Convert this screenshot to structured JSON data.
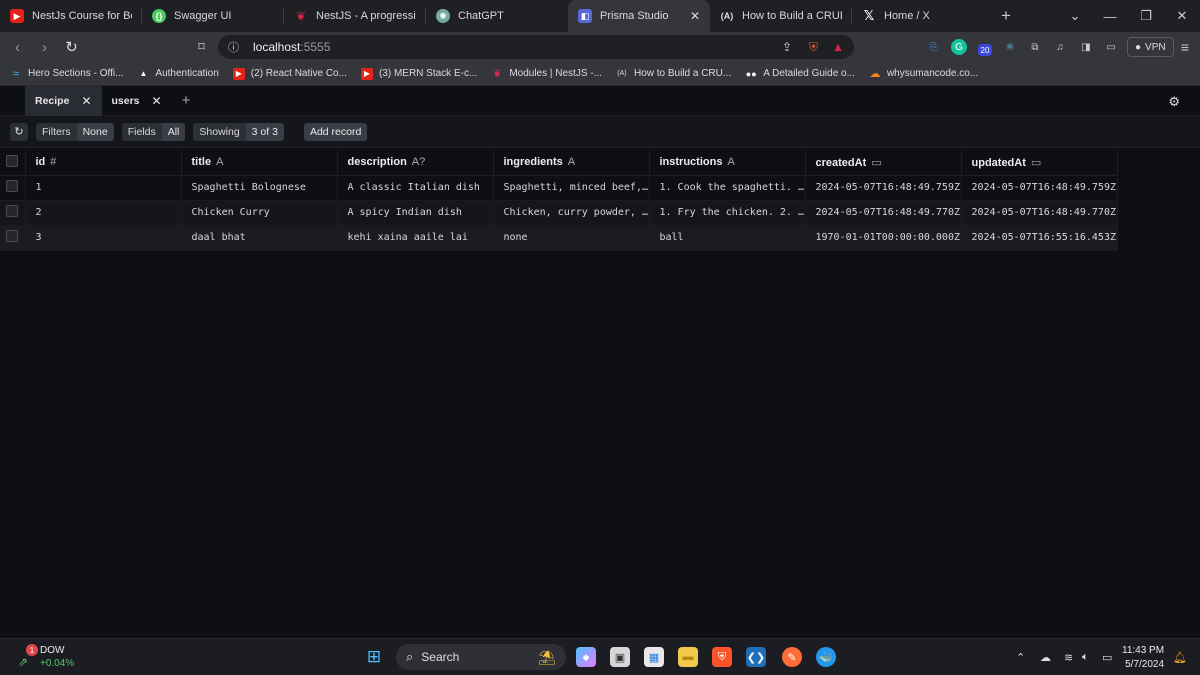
{
  "browser": {
    "tabs": [
      {
        "label": "NestJs Course for Beginne",
        "icon": "youtube-icon",
        "active": false
      },
      {
        "label": "Swagger UI",
        "icon": "swagger-icon",
        "active": false
      },
      {
        "label": "NestJS - A progressive No",
        "icon": "nestjs-icon",
        "active": false
      },
      {
        "label": "ChatGPT",
        "icon": "chatgpt-icon",
        "active": false
      },
      {
        "label": "Prisma Studio",
        "icon": "prisma-icon",
        "active": true
      },
      {
        "label": "How to Build a CRUD RES",
        "icon": "a-icon",
        "active": false
      },
      {
        "label": "Home / X",
        "icon": "x-icon",
        "active": false
      }
    ],
    "new_tab": "+",
    "url_host": "localhost",
    "url_port": ":5555",
    "vpn_label": "VPN",
    "ext_badge": "20",
    "bookmarks": [
      {
        "label": "Hero Sections - Offi...",
        "icon": "wave-icon"
      },
      {
        "label": "Authentication",
        "icon": "triangle-icon"
      },
      {
        "label": "(2) React Native Co...",
        "icon": "youtube-icon"
      },
      {
        "label": "(3) MERN Stack E-c...",
        "icon": "youtube-icon"
      },
      {
        "label": "Modules | NestJS -...",
        "icon": "nestjs-icon"
      },
      {
        "label": "How to Build a CRU...",
        "icon": "a-icon"
      },
      {
        "label": "A Detailed Guide o...",
        "icon": "medium-icon"
      },
      {
        "label": "whysumancode.co...",
        "icon": "cloud-icon"
      }
    ]
  },
  "studio": {
    "model_tabs": [
      {
        "label": "Recipe",
        "active": false
      },
      {
        "label": "users",
        "active": true
      }
    ],
    "toolbar": {
      "filters_label": "Filters",
      "filters_value": "None",
      "fields_label": "Fields",
      "fields_value": "All",
      "showing_label": "Showing",
      "showing_value": "3 of 3",
      "add_record": "Add record"
    },
    "columns": [
      {
        "name": "id",
        "type": "#"
      },
      {
        "name": "title",
        "type": "A"
      },
      {
        "name": "description",
        "type": "A?"
      },
      {
        "name": "ingredients",
        "type": "A"
      },
      {
        "name": "instructions",
        "type": "A"
      },
      {
        "name": "createdAt",
        "type": "▭"
      },
      {
        "name": "updatedAt",
        "type": "▭"
      }
    ],
    "rows": [
      [
        "1",
        "Spaghetti Bolognese",
        "A classic Italian dish",
        "Spaghetti, minced beef,…",
        "1. Cook the spaghetti. …",
        "2024-05-07T16:48:49.759Z",
        "2024-05-07T16:48:49.759Z"
      ],
      [
        "2",
        "Chicken Curry",
        "A spicy Indian dish",
        "Chicken, curry powder, …",
        "1. Fry the chicken. 2. …",
        "2024-05-07T16:48:49.770Z",
        "2024-05-07T16:48:49.770Z"
      ],
      [
        "3",
        "daal bhat",
        "kehi xaina aaile lai",
        "none",
        "ball",
        "1970-01-01T00:00:00.000Z",
        "2024-05-07T16:55:16.453Z"
      ]
    ]
  },
  "taskbar": {
    "stock_name": "DOW",
    "stock_change": "+0.04%",
    "stock_badge": "1",
    "search_label": "Search",
    "time": "11:43 PM",
    "date": "5/7/2024"
  }
}
